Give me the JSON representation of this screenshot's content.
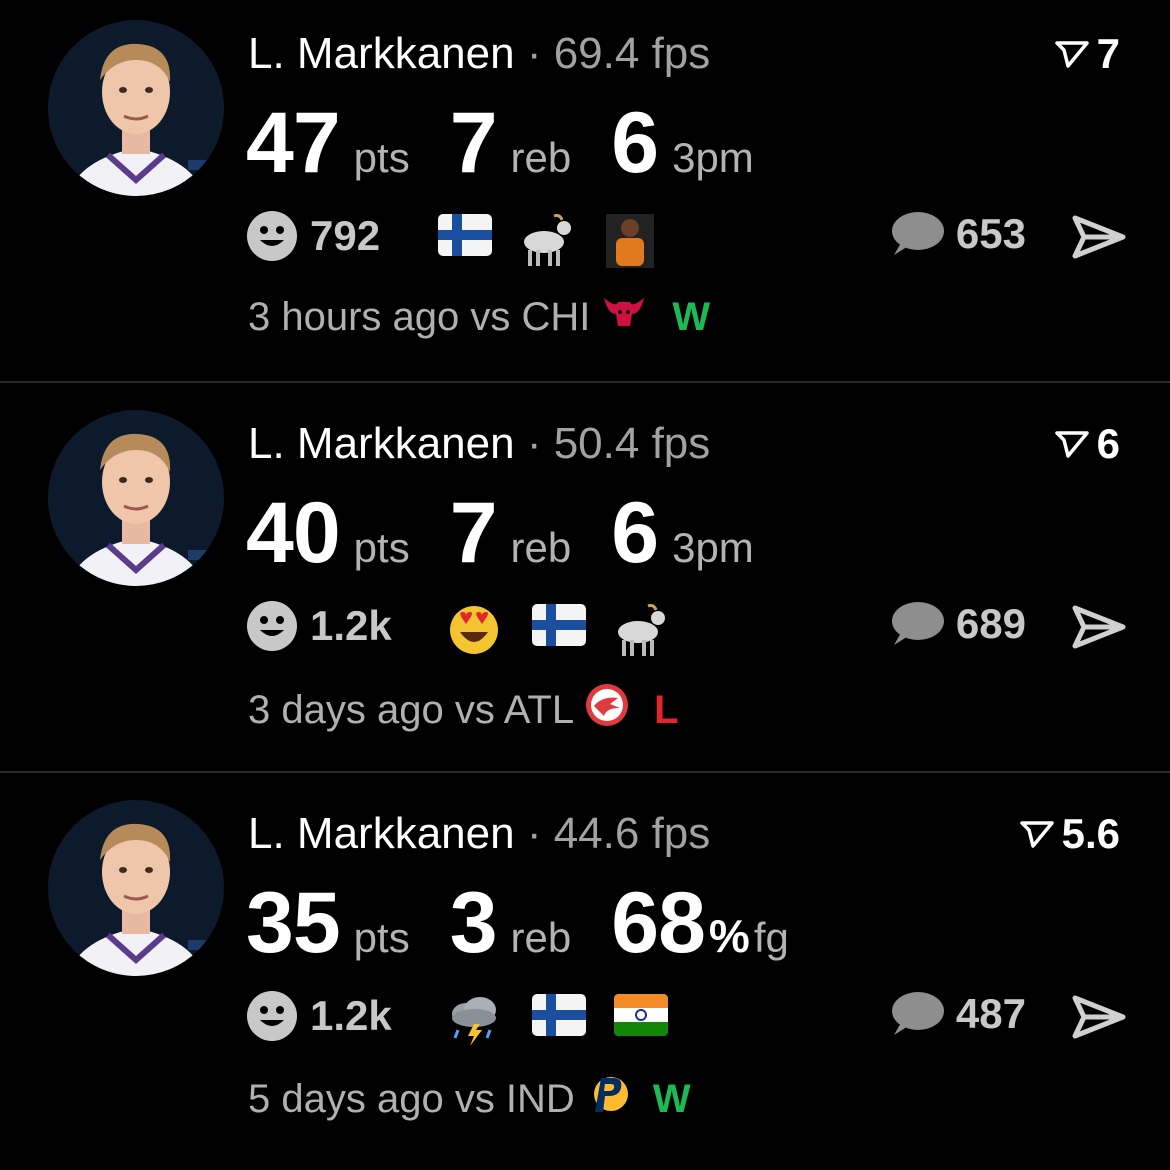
{
  "colors": {
    "background": "#000000",
    "win": "#1db954",
    "loss": "#e5242c",
    "muted": "#a2a2a2"
  },
  "posts": [
    {
      "player": "L. Markkanen",
      "separator": "·",
      "fps": "69.4 fps",
      "rank": "7",
      "stats": [
        {
          "value": "47",
          "unit": "pts"
        },
        {
          "value": "7",
          "unit": "reb"
        },
        {
          "value": "6",
          "unit": "3pm"
        }
      ],
      "reactions": "792",
      "emojis": [
        "finland-flag",
        "goat",
        "person-emoji"
      ],
      "comments": "653",
      "time": "3 hours ago vs CHI",
      "opponent_logo": "bulls-logo",
      "result": "W"
    },
    {
      "player": "L. Markkanen",
      "separator": "·",
      "fps": "50.4 fps",
      "rank": "6",
      "stats": [
        {
          "value": "40",
          "unit": "pts"
        },
        {
          "value": "7",
          "unit": "reb"
        },
        {
          "value": "6",
          "unit": "3pm"
        }
      ],
      "reactions": "1.2k",
      "emojis": [
        "heart-eyes",
        "finland-flag",
        "goat"
      ],
      "comments": "689",
      "time": "3 days ago vs ATL",
      "opponent_logo": "hawks-logo",
      "result": "L"
    },
    {
      "player": "L. Markkanen",
      "separator": "·",
      "fps": "44.6 fps",
      "rank": "5.6",
      "stats": [
        {
          "value": "35",
          "unit": "pts"
        },
        {
          "value": "3",
          "unit": "reb"
        },
        {
          "value": "68",
          "pct": "%",
          "unit": "fg"
        }
      ],
      "reactions": "1.2k",
      "emojis": [
        "storm-cloud",
        "finland-flag",
        "india-flag"
      ],
      "comments": "487",
      "time": "5 days ago vs IND",
      "opponent_logo": "pacers-logo",
      "result": "W"
    }
  ]
}
